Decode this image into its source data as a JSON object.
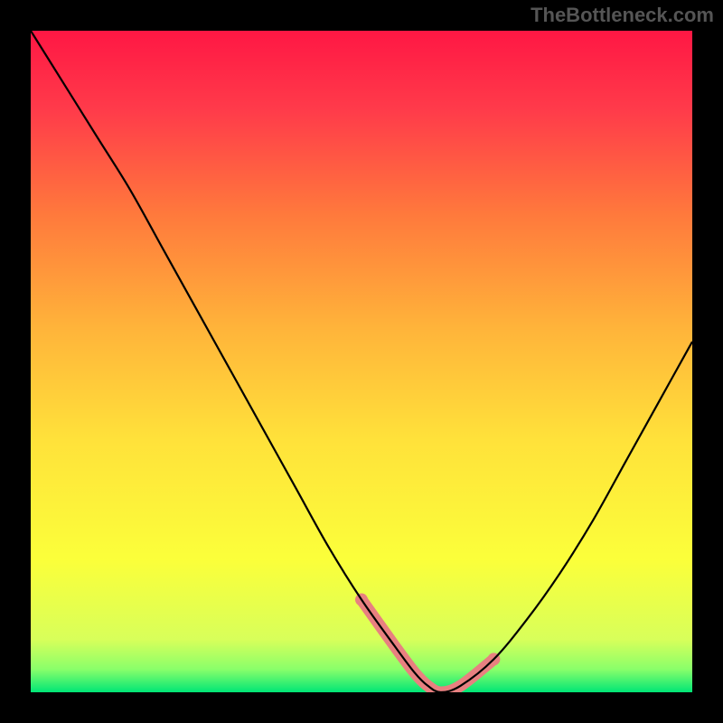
{
  "watermark": "TheBottleneck.com",
  "chart_data": {
    "type": "line",
    "title": "",
    "xlabel": "",
    "ylabel": "",
    "xlim": [
      0,
      100
    ],
    "ylim": [
      0,
      100
    ],
    "x": [
      0,
      5,
      10,
      15,
      20,
      25,
      30,
      35,
      40,
      45,
      50,
      55,
      58,
      60,
      62,
      65,
      70,
      75,
      80,
      85,
      90,
      95,
      100
    ],
    "values": [
      100,
      92,
      84,
      76,
      67,
      58,
      49,
      40,
      31,
      22,
      14,
      7,
      3,
      1,
      0,
      1,
      5,
      11,
      18,
      26,
      35,
      44,
      53
    ],
    "min_band": {
      "x_start": 50,
      "x_end": 68,
      "y": 2
    },
    "gradient_stops": [
      {
        "pos": 0.0,
        "color": "#ff1744"
      },
      {
        "pos": 0.12,
        "color": "#ff3b4a"
      },
      {
        "pos": 0.28,
        "color": "#ff7a3c"
      },
      {
        "pos": 0.45,
        "color": "#ffb43a"
      },
      {
        "pos": 0.62,
        "color": "#ffe23a"
      },
      {
        "pos": 0.8,
        "color": "#fbff3a"
      },
      {
        "pos": 0.92,
        "color": "#d8ff5a"
      },
      {
        "pos": 0.965,
        "color": "#8aff6a"
      },
      {
        "pos": 1.0,
        "color": "#00e676"
      }
    ],
    "pink_color": "#e88080"
  }
}
